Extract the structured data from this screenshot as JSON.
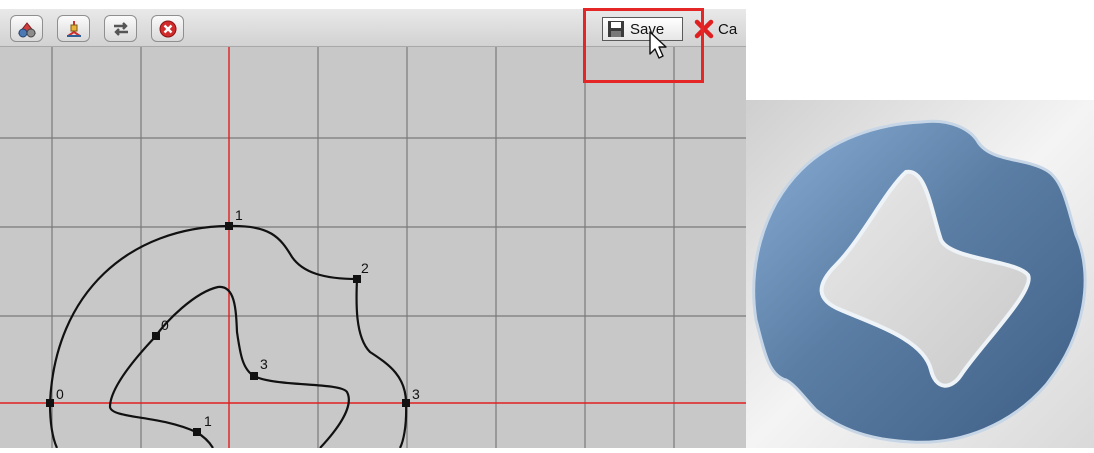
{
  "toolbar": {
    "tools": [
      {
        "name": "shape-tool-button",
        "icon": "shapes-icon"
      },
      {
        "name": "transform-tool-button",
        "icon": "transform-icon"
      },
      {
        "name": "swap-tool-button",
        "icon": "swap-arrows-icon"
      },
      {
        "name": "delete-tool-button",
        "icon": "red-circle-x-icon"
      }
    ],
    "save_label": "Save",
    "cancel_label": "Ca",
    "save_icon": "floppy-disk-icon",
    "cancel_icon": "red-x-icon"
  },
  "canvas": {
    "outer_points": [
      "0",
      "1",
      "2",
      "3"
    ],
    "inner_points": [
      "0",
      "1",
      "3"
    ]
  },
  "colors": {
    "accent_red": "#e42626",
    "grid_line": "#7a7a7a",
    "axis_line": "#e02020",
    "canvas_bg": "#c8c8c8",
    "preview_blue": "#5b7ea5"
  }
}
